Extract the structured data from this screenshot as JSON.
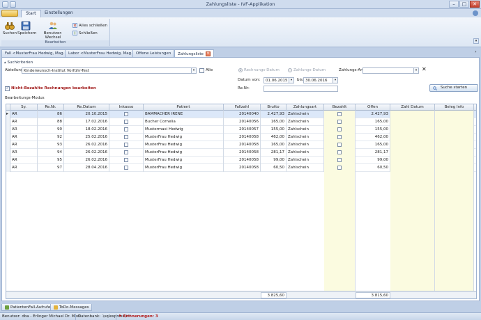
{
  "window": {
    "title": "Zahlungsliste - IVF-Applikation"
  },
  "ribbon": {
    "tabs": [
      {
        "label": "Start",
        "active": true
      },
      {
        "label": "Einstellungen",
        "active": false
      }
    ],
    "group_label": "Bearbeiten",
    "buttons": {
      "suchen": "Suchen",
      "speichern": "Speichern",
      "benutzer_wechsel": "Benutzer-Wechsel",
      "alles_schliessen": "Alles schließen",
      "schliessen": "Schließen"
    }
  },
  "doc_tabs": [
    {
      "label": "Fall <MusterFrau Hedwig, Mag.>"
    },
    {
      "label": "Labor <MusterFrau Hedwig, Mag.>"
    },
    {
      "label": "Offene Leistungen"
    },
    {
      "label": "Zahlungsliste",
      "active": true
    }
  ],
  "search": {
    "section_label": "Suchkriterien",
    "abteilung_label": "Abteilung:",
    "abteilung_value": "Kinderwunsch-Institut Vorführ-Test",
    "alle_label": "Alle",
    "rechnungs_datum_label": "Rechnungs-Datum",
    "zahlungs_datum_label": "Zahlungs-Datum",
    "zahlungsart_label": "Zahlungs-Art:",
    "zahlungsart_value": "",
    "datum_von_label": "Datum von:",
    "datum_von_value": "01.06.2015",
    "bis_label": "bis:",
    "bis_value": "30.06.2016",
    "renr_label": "Re.Nr:",
    "renr_value": "",
    "nicht_bezahlt_label": "Nicht-Bezahlte Rechnungen bearbeiten",
    "nicht_bezahlt_checked": true,
    "search_button": "Suche starten"
  },
  "grid": {
    "section_label": "Bearbeitungs-Modus",
    "columns": [
      "Sy.",
      "Re.Nr.",
      "Re.Datum",
      "Inkasso",
      "Patient",
      "Fallzahl",
      "Brutto",
      "Zahlungsart",
      "Bezahlt",
      "Offen",
      "Zahl Datum",
      "Beleg Info"
    ],
    "rows": [
      {
        "sy": "AR",
        "renr": "86",
        "datum": "20.10.2015",
        "patient": "BAMMACHER IRENE",
        "fallzahl": "20140040",
        "brutto": "2.427,93",
        "zahlungsart": "Zahlschein",
        "offen": "2.427,93"
      },
      {
        "sy": "AR",
        "renr": "88",
        "datum": "17.02.2016",
        "patient": "Bucher Cornelia",
        "fallzahl": "20140056",
        "brutto": "165,00",
        "zahlungsart": "Zahlschein",
        "offen": "165,00"
      },
      {
        "sy": "AR",
        "renr": "90",
        "datum": "18.02.2016",
        "patient": "Mustermaxi Hedwig",
        "fallzahl": "20140057",
        "brutto": "155,00",
        "zahlungsart": "Zahlschein",
        "offen": "155,00"
      },
      {
        "sy": "AR",
        "renr": "92",
        "datum": "25.02.2016",
        "patient": "MusterFrau Hedwig",
        "fallzahl": "20140058",
        "brutto": "462,00",
        "zahlungsart": "Zahlschein",
        "offen": "462,00"
      },
      {
        "sy": "AR",
        "renr": "93",
        "datum": "26.02.2016",
        "patient": "MusterFrau Hedwig",
        "fallzahl": "20140058",
        "brutto": "165,00",
        "zahlungsart": "Zahlschein",
        "offen": "165,00"
      },
      {
        "sy": "AR",
        "renr": "94",
        "datum": "26.02.2016",
        "patient": "MusterFrau Hedwig",
        "fallzahl": "20140058",
        "brutto": "281,17",
        "zahlungsart": "Zahlschein",
        "offen": "281,17"
      },
      {
        "sy": "AR",
        "renr": "95",
        "datum": "26.02.2016",
        "patient": "MusterFrau Hedwig",
        "fallzahl": "20140058",
        "brutto": "99,00",
        "zahlungsart": "Zahlschein",
        "offen": "99,00"
      },
      {
        "sy": "AR",
        "renr": "97",
        "datum": "28.04.2016",
        "patient": "MusterFrau Hedwig",
        "fallzahl": "20140058",
        "brutto": "60,50",
        "zahlungsart": "Zahlschein",
        "offen": "60,50"
      }
    ],
    "footer": {
      "brutto_sum": "3.825,60",
      "offen_sum": "3.815,60"
    }
  },
  "bottom_tabs": [
    {
      "label": "PatientenFall-Aufrufe"
    },
    {
      "label": "ToDo-Messages"
    }
  ],
  "status": {
    "benutzer": "Benutzer: dba - Erlinger Michael Dr. Med.",
    "datenbank": "Datenbank: .\\sqlexpress\\ivf",
    "erinnerungen": "Erinnerungen: 3"
  }
}
